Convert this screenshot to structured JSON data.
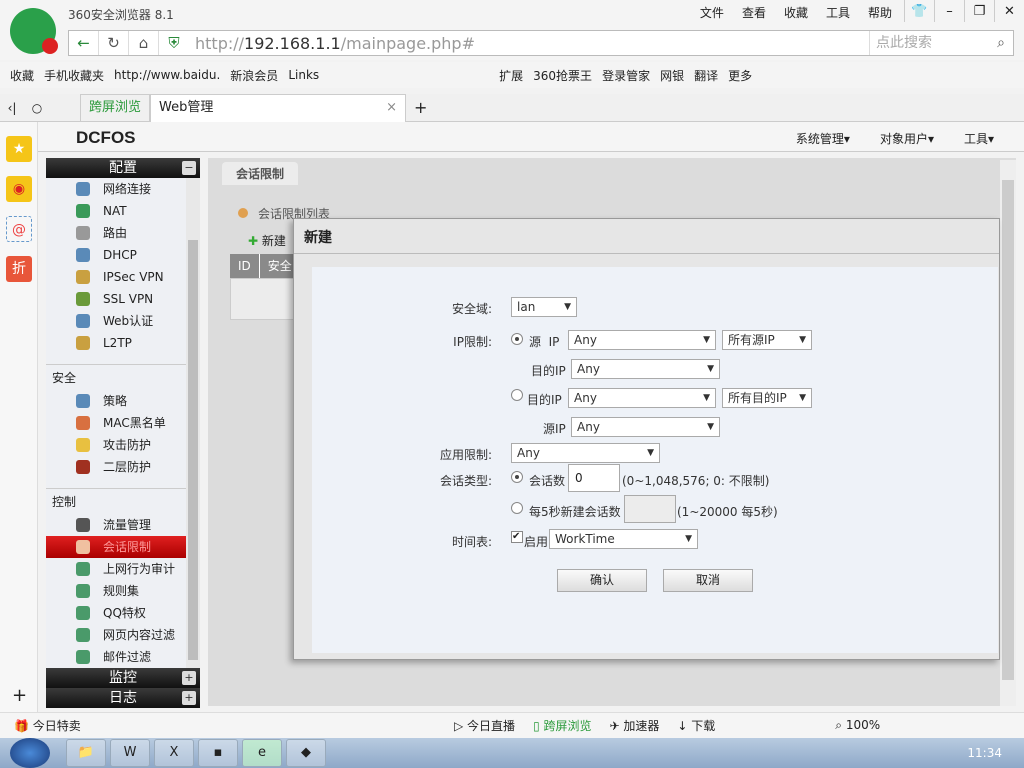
{
  "browser": {
    "title": "360安全浏览器 8.1",
    "menus": [
      "文件",
      "查看",
      "收藏",
      "工具",
      "帮助"
    ],
    "url_prefix": "http://",
    "url_host": "192.168.1.1",
    "url_path": "/mainpage.php#",
    "search_placeholder": "点此搜索",
    "bookmarks": [
      "收藏",
      "手机收藏夹",
      "http://www.baidu.",
      "新浪会员",
      "Links"
    ],
    "bookmarks_right": [
      "扩展",
      "360抢票王",
      "登录管家",
      "网银",
      "翻译",
      "更多"
    ],
    "tabs": [
      {
        "label": "跨屏浏览"
      },
      {
        "label": "Web管理"
      }
    ]
  },
  "app": {
    "brand": "DCFOS",
    "topnav": [
      "系统管理▾",
      "对象用户▾",
      "工具▾"
    ]
  },
  "nav": {
    "sections": [
      {
        "label": "配置",
        "toggle": "−"
      },
      {
        "label": "监控",
        "toggle": "+"
      },
      {
        "label": "日志",
        "toggle": "+"
      }
    ],
    "config_items": [
      "网络连接",
      "NAT",
      "路由",
      "DHCP",
      "IPSec VPN",
      "SSL VPN",
      "Web认证",
      "L2TP"
    ],
    "security_label": "安全",
    "security_items": [
      "策略",
      "MAC黑名单",
      "攻击防护",
      "二层防护"
    ],
    "control_label": "控制",
    "control_items": [
      "流量管理",
      "会话限制",
      "上网行为审计",
      "规则集",
      "QQ特权",
      "网页内容过滤",
      "邮件过滤"
    ]
  },
  "content": {
    "tab": "会话限制",
    "list_title": "会话限制列表",
    "new_label": "新建",
    "col_id": "ID",
    "col_zone": "安全"
  },
  "dialog": {
    "title": "新建",
    "zone_label": "安全域:",
    "zone_value": "lan",
    "ip_label": "IP限制:",
    "src_ip_label": "源  IP",
    "src_ip_value": "Any",
    "src_scope": "所有源IP",
    "dst_ip_sub_label": "目的IP",
    "dst_ip_sub_value": "Any",
    "dst_ip_label": "目的IP",
    "dst_ip_value": "Any",
    "dst_scope": "所有目的IP",
    "src_ip_sub_label": "源IP",
    "src_ip_sub_value": "Any",
    "app_label": "应用限制:",
    "app_value": "Any",
    "type_label": "会话类型:",
    "sessions_label": "会话数",
    "sessions_value": "0",
    "sessions_hint": "(0~1,048,576; 0: 不限制)",
    "rate_label": "每5秒新建会话数",
    "rate_value": "",
    "rate_hint": "(1~20000 每5秒)",
    "schedule_label": "时间表:",
    "enable_label": "启用",
    "schedule_value": "WorkTime",
    "ok": "确认",
    "cancel": "取消"
  },
  "status": {
    "left": "今日特卖",
    "items": [
      "今日直播",
      "跨屏浏览",
      "加速器",
      "下载"
    ],
    "zoom": "100%"
  },
  "taskbar": {
    "clock": "11:34"
  }
}
